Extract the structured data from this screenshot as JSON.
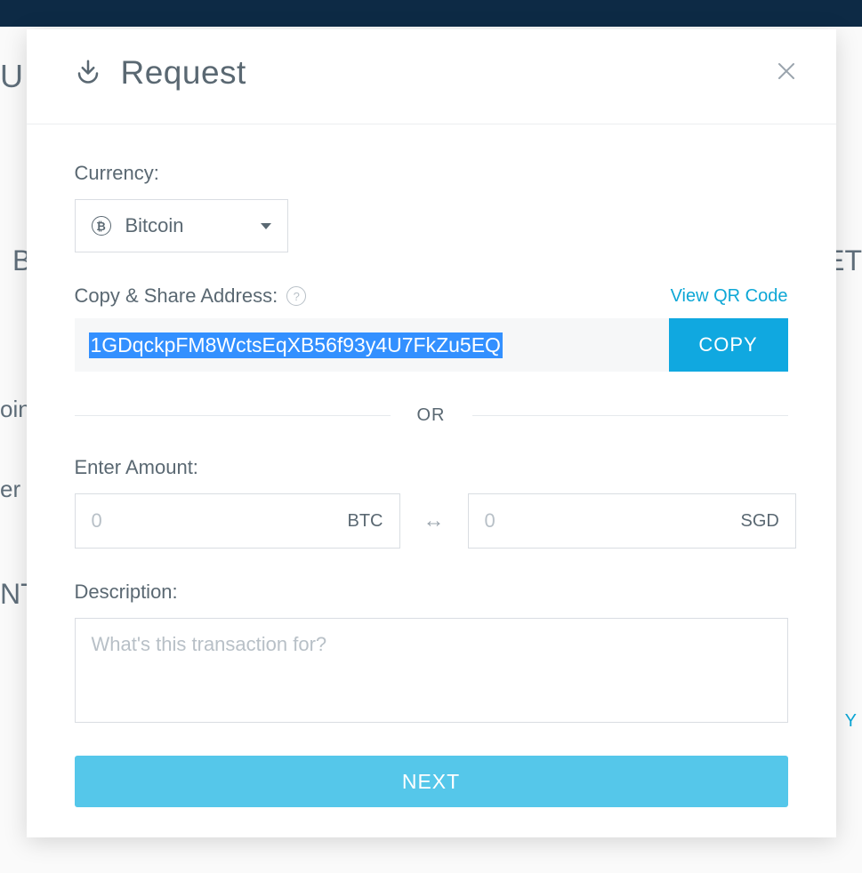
{
  "modal": {
    "title": "Request",
    "currency_label": "Currency:",
    "currency_selected": "Bitcoin",
    "address_label": "Copy & Share Address:",
    "qr_link": "View QR Code",
    "address": "1GDqckpFM8WctsEqXB56f93y4U7FkZu5EQ",
    "copy_button": "COPY",
    "divider": "OR",
    "amount_label": "Enter Amount:",
    "amount_btc_placeholder": "0",
    "amount_btc_unit": "BTC",
    "amount_fiat_placeholder": "0",
    "amount_fiat_unit": "SGD",
    "description_label": "Description:",
    "description_placeholder": "What's this transaction for?",
    "next_button": "NEXT"
  },
  "background": {
    "frag_u": "U",
    "frag_b": "B",
    "frag_et": "ET",
    "frag_oin": "oin",
    "frag_erw": "er W",
    "frag_nt": "NT",
    "frag_y": "Y"
  }
}
